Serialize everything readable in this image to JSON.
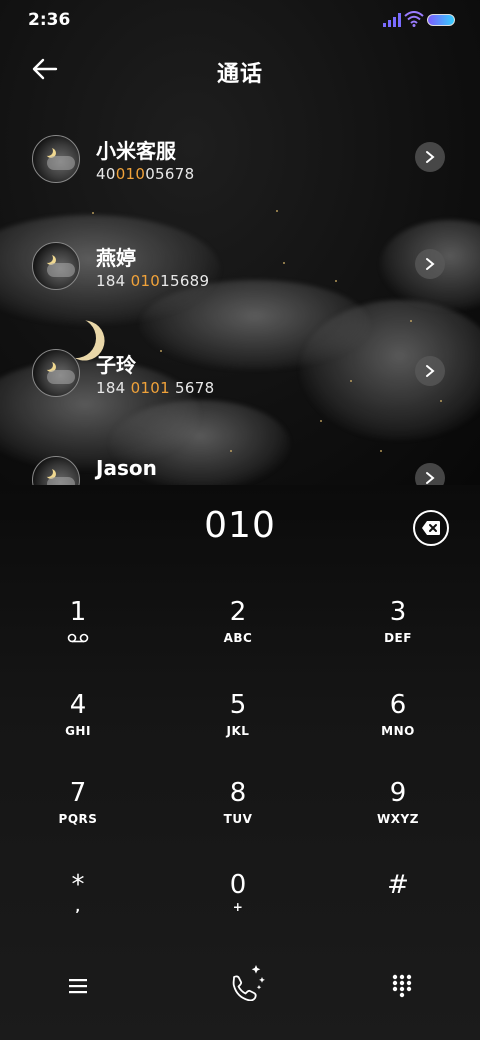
{
  "status": {
    "time": "2:36"
  },
  "header": {
    "title": "通话"
  },
  "contacts": [
    {
      "name": "小米客服",
      "num_pre": "40",
      "num_hl": "010",
      "num_post": "05678"
    },
    {
      "name": "燕婷",
      "num_pre": "184 ",
      "num_hl": "010",
      "num_post": "15689"
    },
    {
      "name": "子玲",
      "num_pre": "184 ",
      "num_hl": "0101",
      "num_post": " 5678"
    },
    {
      "name": "Jason",
      "num_pre": "",
      "num_hl": "",
      "num_post": ""
    }
  ],
  "dialer": {
    "input": "010",
    "keys": [
      {
        "digit": "1",
        "letters": ""
      },
      {
        "digit": "2",
        "letters": "ABC"
      },
      {
        "digit": "3",
        "letters": "DEF"
      },
      {
        "digit": "4",
        "letters": "GHI"
      },
      {
        "digit": "5",
        "letters": "JKL"
      },
      {
        "digit": "6",
        "letters": "MNO"
      },
      {
        "digit": "7",
        "letters": "PQRS"
      },
      {
        "digit": "8",
        "letters": "TUV"
      },
      {
        "digit": "9",
        "letters": "WXYZ"
      },
      {
        "digit": "*",
        "letters": ","
      },
      {
        "digit": "0",
        "letters": "+"
      },
      {
        "digit": "#",
        "letters": ""
      }
    ]
  },
  "icons": {
    "back": "back-arrow-icon",
    "chevron": "chevron-right-icon",
    "backspace": "backspace-icon",
    "voicemail": "voicemail-icon",
    "menu": "menu-icon",
    "call": "call-icon",
    "dialpad": "dialpad-icon"
  },
  "colors": {
    "highlight": "#f0a23a",
    "background": "#0c0c0c"
  }
}
